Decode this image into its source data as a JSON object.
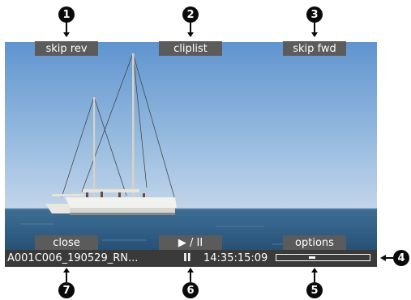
{
  "buttons": {
    "skip_rev": "skip rev",
    "cliplist": "cliplist",
    "skip_fwd": "skip fwd",
    "close": "close",
    "play_pause": "▶ / II",
    "options": "options"
  },
  "status": {
    "clip_name": "A001C006_190529_RN...",
    "state": "II",
    "timecode": "14:35:15:09",
    "progress": 0.37
  },
  "callouts": [
    "1",
    "2",
    "3",
    "4",
    "5",
    "6",
    "7"
  ]
}
